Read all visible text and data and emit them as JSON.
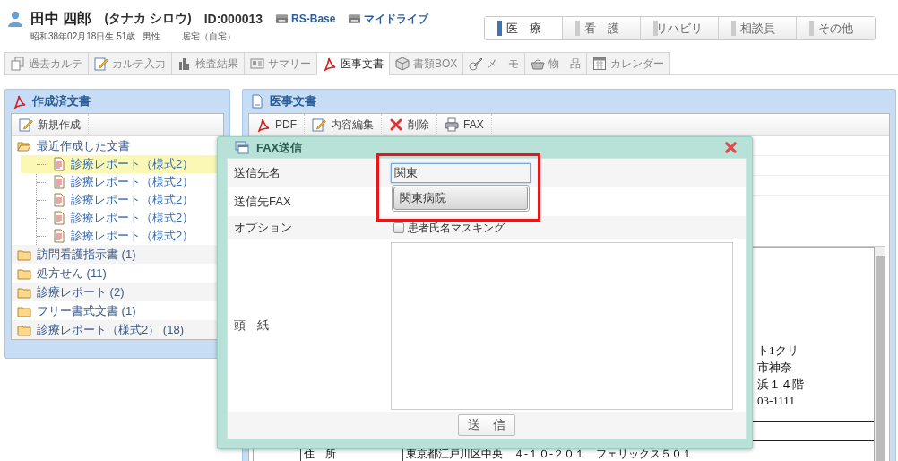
{
  "patient": {
    "name": "田中 四郎",
    "kana": "(タナカ シロウ)",
    "id": "ID:000013",
    "links": [
      "RS-Base",
      "マイドライブ"
    ],
    "birth": "昭和38年02月18日生 51歳",
    "sex": "男性",
    "residence": "居宅（自宅）"
  },
  "departments": [
    {
      "label": "医　療",
      "selected": true
    },
    {
      "label": "看　護",
      "selected": false
    },
    {
      "label": "リハビリ",
      "selected": false
    },
    {
      "label": "相談員",
      "selected": false
    },
    {
      "label": "その他",
      "selected": false
    }
  ],
  "tabs": [
    {
      "label": "過去カルテ",
      "selected": false
    },
    {
      "label": "カルテ入力",
      "selected": false
    },
    {
      "label": "検査結果",
      "selected": false
    },
    {
      "label": "サマリー",
      "selected": false
    },
    {
      "label": "医事文書",
      "selected": true
    },
    {
      "label": "書類BOX",
      "selected": false
    },
    {
      "label": "メ　モ",
      "selected": false
    },
    {
      "label": "物　品",
      "selected": false
    },
    {
      "label": "カレンダー",
      "selected": false
    }
  ],
  "created_docs": {
    "title": "作成済文書",
    "toolbar": [
      "新規作成"
    ],
    "tree": [
      {
        "label": "最近作成した文書",
        "expanded": true,
        "children": [
          {
            "label": "診療レポート（様式2）",
            "selected": true
          },
          {
            "label": "診療レポート（様式2）",
            "selected": false
          },
          {
            "label": "診療レポート（様式2）",
            "selected": false
          },
          {
            "label": "診療レポート（様式2）",
            "selected": false
          },
          {
            "label": "診療レポート（様式2）",
            "selected": false
          }
        ]
      },
      {
        "label": "訪問看護指示書 (1)",
        "expanded": false
      },
      {
        "label": "処方せん (11)",
        "expanded": false
      },
      {
        "label": "診療レポート (2)",
        "expanded": false
      },
      {
        "label": "フリー書式文書 (1)",
        "expanded": false
      },
      {
        "label": "診療レポート（様式2） (18)",
        "expanded": false
      }
    ]
  },
  "medical_docs": {
    "title": "医事文書",
    "toolbar": [
      "PDF",
      "内容編集",
      "削除",
      "FAX"
    ],
    "document_lines": [
      "ト1クリ",
      "市神奈",
      "浜１４階",
      "03-1111"
    ],
    "address_row": {
      "label": "住　所",
      "value": "東京都江戸川区中央　４-１０-２０１　フェリックス５０１"
    }
  },
  "fax_dialog": {
    "title": "FAX送信",
    "fields": [
      {
        "kind": "text",
        "label": "送信先名",
        "value": "関東",
        "suggestions": [
          "関東病院"
        ],
        "highlighted": true
      },
      {
        "kind": "text",
        "label": "送信先FAX"
      },
      {
        "kind": "checkbox",
        "label": "オプション",
        "option": "患者氏名マスキング",
        "checked": false
      },
      {
        "kind": "textarea",
        "label": "頭　紙"
      }
    ],
    "submit": "送　信"
  }
}
